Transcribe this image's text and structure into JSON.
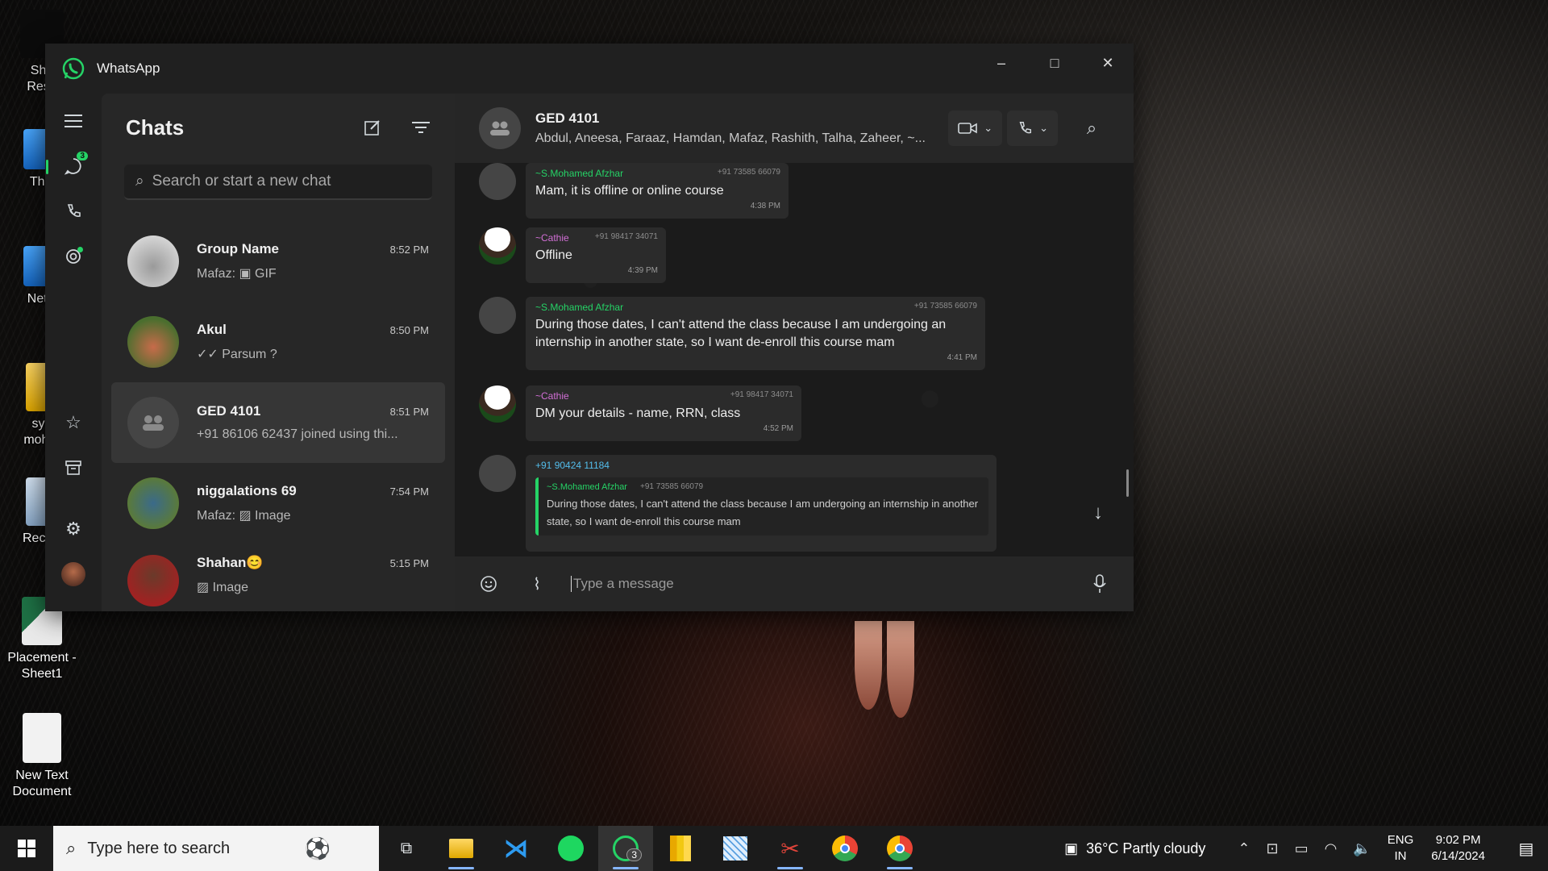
{
  "desktop": {
    "icons": [
      {
        "label": "Sho\nResu"
      },
      {
        "label": "This"
      },
      {
        "label": "Netw"
      },
      {
        "label": "sye\nmohar"
      },
      {
        "label": "Recycl"
      },
      {
        "label": "Placement -\nSheet1"
      },
      {
        "label": "New Text\nDocument"
      }
    ]
  },
  "window": {
    "title": "WhatsApp",
    "controls": {
      "minimize": "–",
      "maximize": "□",
      "close": "✕"
    }
  },
  "rail": {
    "chats_badge": "3"
  },
  "chat_list": {
    "title": "Chats",
    "search_placeholder": "Search or start a new chat",
    "items": [
      {
        "name": "Group Name",
        "time": "8:52 PM",
        "preview": "Mafaz: ▣ GIF"
      },
      {
        "name": "Akul",
        "time": "8:50 PM",
        "preview": "✓✓ Parsum ?"
      },
      {
        "name": "GED 4101",
        "time": "8:51 PM",
        "preview": "+91 86106 62437 joined using thi..."
      },
      {
        "name": "niggalations 69",
        "time": "7:54 PM",
        "preview": "Mafaz: ▨ Image"
      },
      {
        "name": "Shahan😊",
        "time": "5:15 PM",
        "preview": "▨ Image"
      }
    ]
  },
  "conversation": {
    "title": "GED 4101",
    "members": "Abdul, Aneesa, Faraaz, Hamdan, Mafaz, Rashith, Talha, Zaheer, ~...",
    "messages": [
      {
        "sender": "~S.Mohamed Afzhar",
        "phone": "+91 73585 66079",
        "text": "Mam, it is offline or online course",
        "time": "4:38 PM"
      },
      {
        "sender": "~Cathie",
        "phone": "+91 98417 34071",
        "text": "Offline",
        "time": "4:39 PM"
      },
      {
        "sender": "~S.Mohamed Afzhar",
        "phone": "+91 73585 66079",
        "text": "During those dates, I can't attend the class because I am undergoing an internship  in another state, so I want de-enroll this course mam",
        "time": "4:41 PM"
      },
      {
        "sender": "~Cathie",
        "phone": "+91 98417 34071",
        "text": "DM your details - name, RRN, class",
        "time": "4:52 PM"
      },
      {
        "sender": "+91 90424 11184",
        "quote": {
          "sender": "~S.Mohamed Afzhar",
          "phone": "+91 73585 66079",
          "text": "During those dates, I can't attend the class because I am undergoing an internship  in another state, so I want de-enroll this course mam"
        }
      }
    ],
    "composer_placeholder": "Type a message"
  },
  "taskbar": {
    "search_placeholder": "Type here to search",
    "whatsapp_badge": "3",
    "weather": "36°C  Partly cloudy",
    "lang_top": "ENG",
    "lang_bottom": "IN",
    "time": "9:02 PM",
    "date": "6/14/2024"
  },
  "colors": {
    "accent": "#25d366",
    "window_bg": "#202020",
    "chat_pane": "#272727"
  }
}
